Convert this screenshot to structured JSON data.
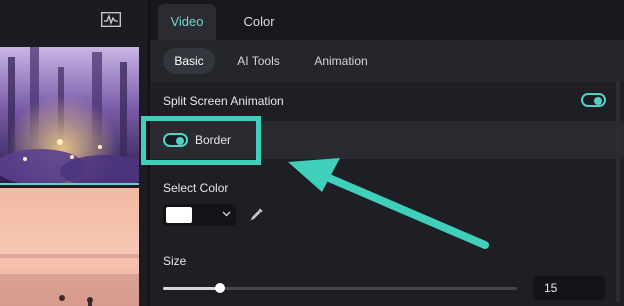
{
  "tabs": {
    "video": "Video",
    "color": "Color"
  },
  "subtabs": {
    "basic": "Basic",
    "ai_tools": "AI Tools",
    "animation": "Animation"
  },
  "split_screen": {
    "label": "Split Screen Animation",
    "enabled": true
  },
  "border": {
    "label": "Border",
    "enabled": true
  },
  "select_color": {
    "label": "Select Color",
    "value": "#FFFFFF"
  },
  "size": {
    "label": "Size",
    "value": "15",
    "slider_fraction": 0.16
  },
  "colors": {
    "accent": "#53D1C3",
    "annotation": "#3FCFBB"
  },
  "icons": {
    "waveform": "waveform-icon",
    "eyedropper": "eyedropper-icon",
    "chevron": "chevron-down-icon"
  }
}
